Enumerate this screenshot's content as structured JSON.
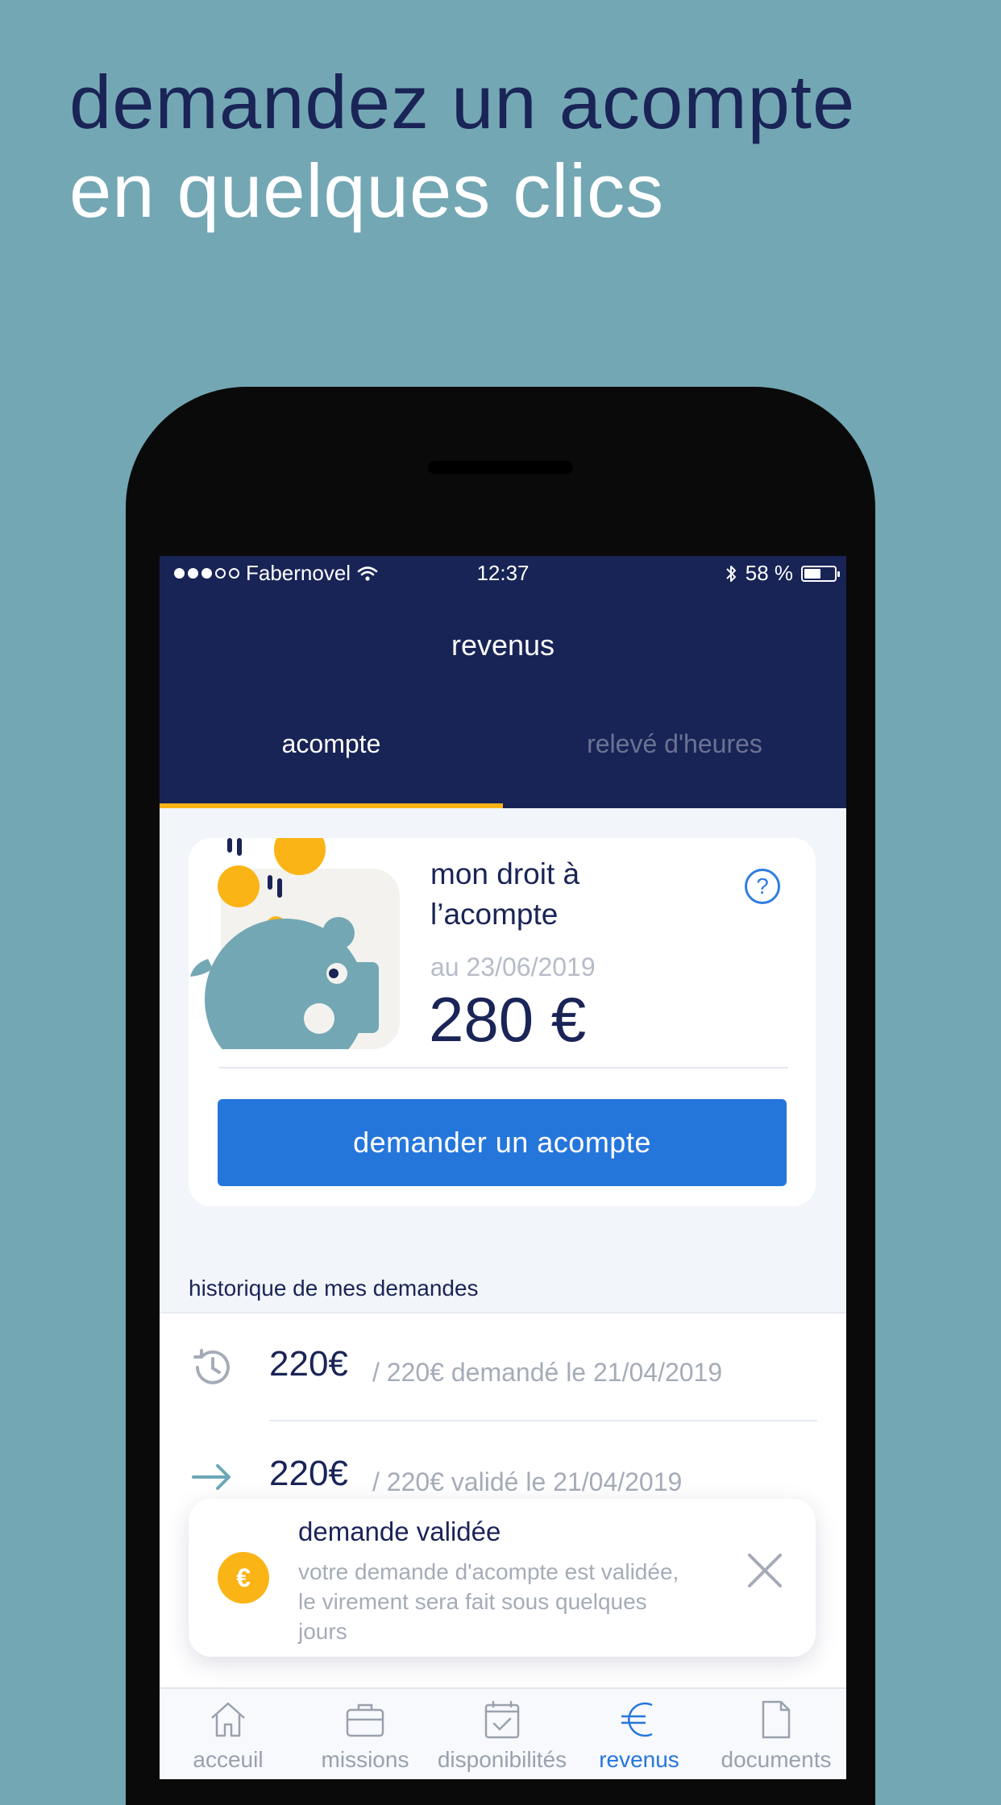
{
  "headline": {
    "line1": "demandez un acompte",
    "line2": "en quelques clics"
  },
  "status_bar": {
    "carrier": "Fabernovel",
    "time": "12:37",
    "battery": "58 %",
    "signal_bars": 3
  },
  "nav": {
    "title": "revenus"
  },
  "tabs": [
    {
      "label": "acompte",
      "active": true
    },
    {
      "label": "relevé d'heures",
      "active": false
    }
  ],
  "card": {
    "title": "mon droit à l’acompte",
    "help_icon": "?",
    "date": "au 23/06/2019",
    "amount": "280 €",
    "cta_label": "demander un acompte"
  },
  "history": {
    "label": "historique de mes demandes",
    "items": [
      {
        "icon": "clock-icon",
        "amount": "220€",
        "description": "/ 220€ demandé le 21/04/2019"
      },
      {
        "icon": "arrow-right-icon",
        "amount": "220€",
        "description": "/ 220€ validé le 21/04/2019"
      }
    ]
  },
  "toast": {
    "coin_symbol": "€",
    "title": "demande validée",
    "body": "votre demande d'acompte est validée, le virement sera fait sous quelques jours"
  },
  "tabbar": [
    {
      "label": "acceuil",
      "icon": "home-icon",
      "active": false
    },
    {
      "label": "missions",
      "icon": "briefcase-icon",
      "active": false
    },
    {
      "label": "disponibilités",
      "icon": "calendar-check-icon",
      "active": false
    },
    {
      "label": "revenus",
      "icon": "euro-icon",
      "active": true
    },
    {
      "label": "documents",
      "icon": "document-icon",
      "active": false
    }
  ],
  "colors": {
    "background": "#73a7b4",
    "navy": "#182456",
    "accent_yellow": "#fbb416",
    "primary_blue": "#2576db"
  }
}
